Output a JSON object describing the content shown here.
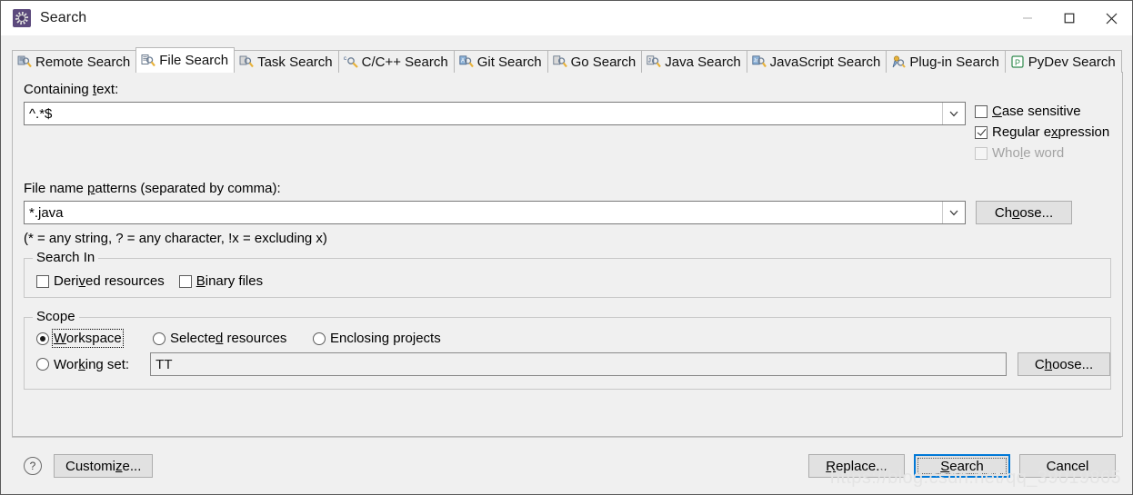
{
  "window": {
    "title": "Search",
    "icon": "eclipse-search-icon",
    "controls": {
      "minimize": "minimize-icon",
      "maximize": "maximize-icon",
      "close": "close-icon"
    }
  },
  "tabs": [
    {
      "label": "Remote Search",
      "icon": "remote-search-icon",
      "active": false
    },
    {
      "label": "File Search",
      "icon": "file-search-icon",
      "active": true
    },
    {
      "label": "Task Search",
      "icon": "task-search-icon",
      "active": false
    },
    {
      "label": "C/C++ Search",
      "icon": "cpp-search-icon",
      "active": false
    },
    {
      "label": "Git Search",
      "icon": "git-search-icon",
      "active": false
    },
    {
      "label": "Go Search",
      "icon": "go-search-icon",
      "active": false
    },
    {
      "label": "Java Search",
      "icon": "java-search-icon",
      "active": false
    },
    {
      "label": "JavaScript Search",
      "icon": "javascript-search-icon",
      "active": false
    },
    {
      "label": "Plug-in Search",
      "icon": "plugin-search-icon",
      "active": false
    },
    {
      "label": "PyDev Search",
      "icon": "pydev-search-icon",
      "active": false
    }
  ],
  "containing_text": {
    "label_before": "Containing ",
    "label_mnemonic": "t",
    "label_after": "ext:",
    "value": "^.*$",
    "dropdown_icon": "chevron-down-icon"
  },
  "options": [
    {
      "name": "case-sensitive",
      "before": "",
      "mnemonic": "C",
      "after": "ase sensitive",
      "checked": false,
      "disabled": false
    },
    {
      "name": "regular-expression",
      "before": "Regular e",
      "mnemonic": "x",
      "after": "pression",
      "checked": true,
      "disabled": false
    },
    {
      "name": "whole-word",
      "before": "Who",
      "mnemonic": "l",
      "after": "e word",
      "checked": false,
      "disabled": true
    }
  ],
  "file_name_patterns": {
    "label_before": "File name ",
    "label_mnemonic": "p",
    "label_after": "atterns (separated by comma):",
    "value": "*.java",
    "dropdown_icon": "chevron-down-icon",
    "hint": "(* = any string, ? = any character, !x = excluding x)",
    "choose_before": "Ch",
    "choose_mnemonic": "o",
    "choose_after": "ose..."
  },
  "search_in": {
    "title": "Search In",
    "items": [
      {
        "name": "derived-resources",
        "before": "Deri",
        "mnemonic": "v",
        "after": "ed resources",
        "checked": false
      },
      {
        "name": "binary-files",
        "before": "",
        "mnemonic": "B",
        "after": "inary files",
        "checked": false
      }
    ]
  },
  "scope": {
    "title": "Scope",
    "radios": [
      {
        "name": "workspace",
        "before": "",
        "mnemonic": "W",
        "after": "orkspace",
        "selected": true,
        "focus": true
      },
      {
        "name": "selected-resources",
        "before": "Selecte",
        "mnemonic": "d",
        "after": " resources",
        "selected": false,
        "focus": false
      },
      {
        "name": "enclosing-projects",
        "before": "Enclosing projects",
        "mnemonic": "",
        "after": "",
        "selected": false,
        "focus": false
      },
      {
        "name": "working-set",
        "before": "Wor",
        "mnemonic": "k",
        "after": "ing set:",
        "selected": false,
        "focus": false
      }
    ],
    "working_set_value": "TT",
    "choose_before": "C",
    "choose_mnemonic": "h",
    "choose_after": "oose..."
  },
  "footer": {
    "help_icon": "help-icon",
    "help_glyph": "?",
    "customize_before": "Customi",
    "customize_mnemonic": "z",
    "customize_after": "e...",
    "replace_before": "",
    "replace_mnemonic": "R",
    "replace_after": "eplace...",
    "search_before": "",
    "search_mnemonic": "S",
    "search_after": "earch",
    "cancel_label": "Cancel"
  },
  "watermark": "https://blog.csdn.net/qq_39019865",
  "colors": {
    "dialog_bg": "#f0f0f0",
    "titlebar_bg": "#ffffff",
    "accent": "#0078d7",
    "field_bg": "#ffffff",
    "border": "#b8b8b8",
    "disabled_text": "#a3a3a3"
  }
}
